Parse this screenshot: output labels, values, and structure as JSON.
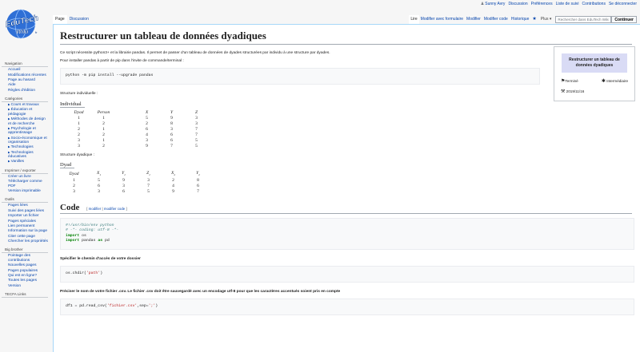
{
  "personal": {
    "user": "Sunny Avry",
    "discussion": "Discussion",
    "preferences": "Préférences",
    "watchlist": "Liste de suivi",
    "contributions": "Contributions",
    "logout": "Se déconnecter"
  },
  "logo": {
    "line1": "EduTech",
    "line2": "Wiki",
    "suffix": "fr"
  },
  "tabs": {
    "page": "Page",
    "discussion": "Discussion",
    "read": "Lire",
    "edit_form": "Modifier avec formulaire",
    "edit": "Modifier",
    "edit_code": "Modifier code",
    "history": "Historique",
    "more": "Plus"
  },
  "search": {
    "placeholder": "Rechercher dans EduTech Wiki",
    "button": "Continuer"
  },
  "sidebar": {
    "navigation": {
      "title": "Navigation",
      "items": [
        "Accueil",
        "Modifications récentes",
        "Page au hasard",
        "Aide",
        "Règles d'édition"
      ]
    },
    "categories": {
      "title": "Catégories",
      "items": [
        "Cours et travaux",
        "Éducation et pédagogie",
        "Méthodes de design et de recherche",
        "Psychologie et apprentissage",
        "Socio-économique et organisation",
        "Technologies",
        "Technologies éducatives",
        "Vanilles"
      ]
    },
    "print": {
      "title": "Imprimer / exporter",
      "items": [
        "Créer un livre",
        "Télécharger comme PDF",
        "Version imprimable"
      ]
    },
    "tools": {
      "title": "Outils",
      "items": [
        "Pages liées",
        "Suivi des pages liées",
        "Importer un fichier",
        "Pages spéciales",
        "Lien permanent",
        "Information sur la page",
        "Citer cette page",
        "Chercher les propriétés"
      ]
    },
    "bigbrother": {
      "title": "Big brother",
      "items": [
        "Pointage des contributions",
        "Nouvelles pages",
        "Pages populaires",
        "Qui est en ligne?",
        "Toutes les pages",
        "Version"
      ]
    },
    "tecfa": {
      "title": "TECFA Links"
    }
  },
  "content": {
    "title": "Restructurer un tableau de données dyadiques",
    "intro": "Ce script nécessite python3+ et la librairie pandas. Il permet de passer d'un tableau de données de dyades structurées par individu à une structure par dyades.",
    "install_intro": "Pour installer pandas à partir de pip dans l'invite de commande/terminal :",
    "install_cmd": "python -m pip install --upgrade pandas",
    "individual_label": "Structure individuelle :",
    "individual_caption": "Individual",
    "individual_headers": [
      "Dyad",
      "Person",
      "X",
      "Y",
      "Z"
    ],
    "individual_rows": [
      [
        "1",
        "1",
        "5",
        "9",
        "3"
      ],
      [
        "1",
        "2",
        "2",
        "8",
        "3"
      ],
      [
        "2",
        "1",
        "6",
        "3",
        "7"
      ],
      [
        "2",
        "2",
        "4",
        "6",
        "7"
      ],
      [
        "3",
        "1",
        "3",
        "6",
        "5"
      ],
      [
        "3",
        "2",
        "9",
        "7",
        "5"
      ]
    ],
    "dyadic_label": "Structure dyadique :",
    "dyadic_caption": "Dyad",
    "dyadic_headers": [
      {
        "base": "Dyad",
        "sub": ""
      },
      {
        "base": "X",
        "sub": "1"
      },
      {
        "base": "Y",
        "sub": "1"
      },
      {
        "base": "Z",
        "sub": "1"
      },
      {
        "base": "X",
        "sub": "2"
      },
      {
        "base": "Y",
        "sub": "2"
      }
    ],
    "dyadic_rows": [
      [
        "1",
        "5",
        "9",
        "3",
        "2",
        "8"
      ],
      [
        "2",
        "6",
        "3",
        "7",
        "4",
        "6"
      ],
      [
        "3",
        "3",
        "6",
        "5",
        "9",
        "7"
      ]
    ],
    "code_heading": "Code",
    "edit_links": {
      "open": "[ ",
      "modifier": "modifier",
      "sep": " | ",
      "modifier_code": "modifier code",
      "close": " ]"
    },
    "code1": {
      "shebang": "#!/usr/bin/env python",
      "coding": "# -*- coding: utf-8 -*-",
      "import1_kw": "import",
      "import1_mod": " os",
      "import2_kw": "import",
      "import2_mod": " pandas ",
      "import2_as": "as",
      "import2_alias": " pd"
    },
    "path_label": "Spécifier le chemin d'accès de votre dossier",
    "code2": {
      "pre": "os.chdir(",
      "str": "'path'",
      "post": ")"
    },
    "csv_label": "Préciser le nom de votre fichier .csv. Le fichier .csv doit être sauvegardé avec un encodage utf-8 pour que les caractères accentués soient pris en compte",
    "code3": {
      "pre": "df1 = pd.read_csv(",
      "str1": "'fichier.csv'",
      "mid": ",sep=",
      "str2": "';'",
      "post": ")"
    }
  },
  "infobox": {
    "title": "Restructurer un tableau de données dyadiques",
    "status": "Terminé",
    "level": "Intermédiaire",
    "date": "2019/11/16"
  }
}
